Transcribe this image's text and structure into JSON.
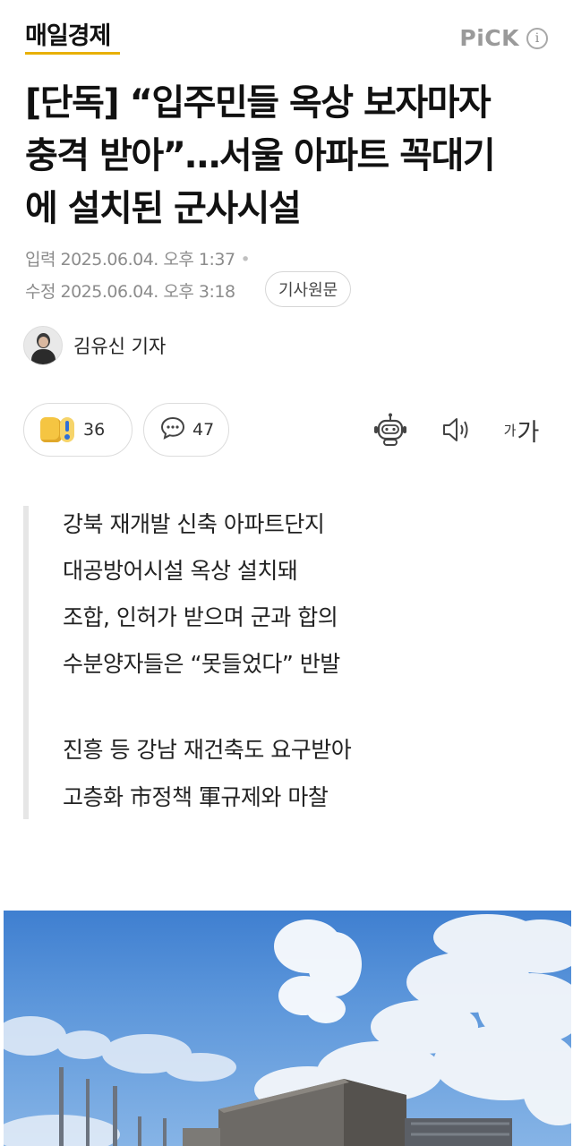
{
  "header": {
    "logo_text": "매일경제",
    "pick_label": "PiCK",
    "info_glyph": "i"
  },
  "article": {
    "headline_lines": [
      "[단독] “입주민들 옥상 보자마자",
      "충격 받아”…서울 아파트 꼭대기",
      "에 설치된 군사시설"
    ],
    "input_date": "입력 2025.06.04. 오후 1:37",
    "modified_date": "수정 2025.06.04. 오후 3:18",
    "source_button": "기사원문",
    "author": "김유신 기자"
  },
  "actions": {
    "reaction_count": "36",
    "comment_count": "47",
    "font_size_small": "가",
    "font_size_large": "가"
  },
  "summary": {
    "lines": [
      "강북 재개발 신축 아파트단지",
      "대공방어시설 옥상 설치돼",
      "조합, 인허가 받으며 군과 합의",
      "수분양자들은 “못들었다” 반발",
      "",
      "진흥 등 강남 재건축도 요구받아",
      "고층화 市정책 軍규제와 마찰"
    ]
  },
  "colors": {
    "logo_underline": "#e8b000",
    "sky": "#4a88d6",
    "text_primary": "#111111",
    "text_secondary": "#8c8c8c"
  },
  "icons": [
    "info-icon",
    "thumbs-up-icon",
    "surprise-icon",
    "comment-icon",
    "robot-icon",
    "speaker-icon",
    "font-size-icon"
  ]
}
